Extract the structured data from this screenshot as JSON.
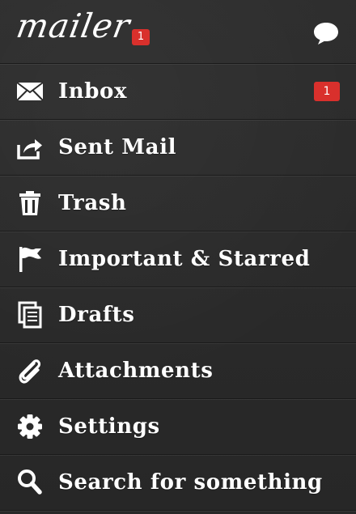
{
  "header": {
    "logo_text": "mailer",
    "badge_count": "1"
  },
  "menu": [
    {
      "label": "Inbox",
      "icon": "envelope-icon",
      "badge": "1"
    },
    {
      "label": "Sent Mail",
      "icon": "share-icon"
    },
    {
      "label": "Trash",
      "icon": "trash-icon"
    },
    {
      "label": "Important & Starred",
      "icon": "flag-icon"
    },
    {
      "label": "Drafts",
      "icon": "drafts-icon"
    },
    {
      "label": "Attachments",
      "icon": "paperclip-icon"
    },
    {
      "label": "Settings",
      "icon": "gear-icon"
    },
    {
      "label": "Search for something",
      "icon": "search-icon"
    }
  ],
  "colors": {
    "background": "#2b2b2b",
    "badge": "#d9302c",
    "text": "#ffffff"
  }
}
